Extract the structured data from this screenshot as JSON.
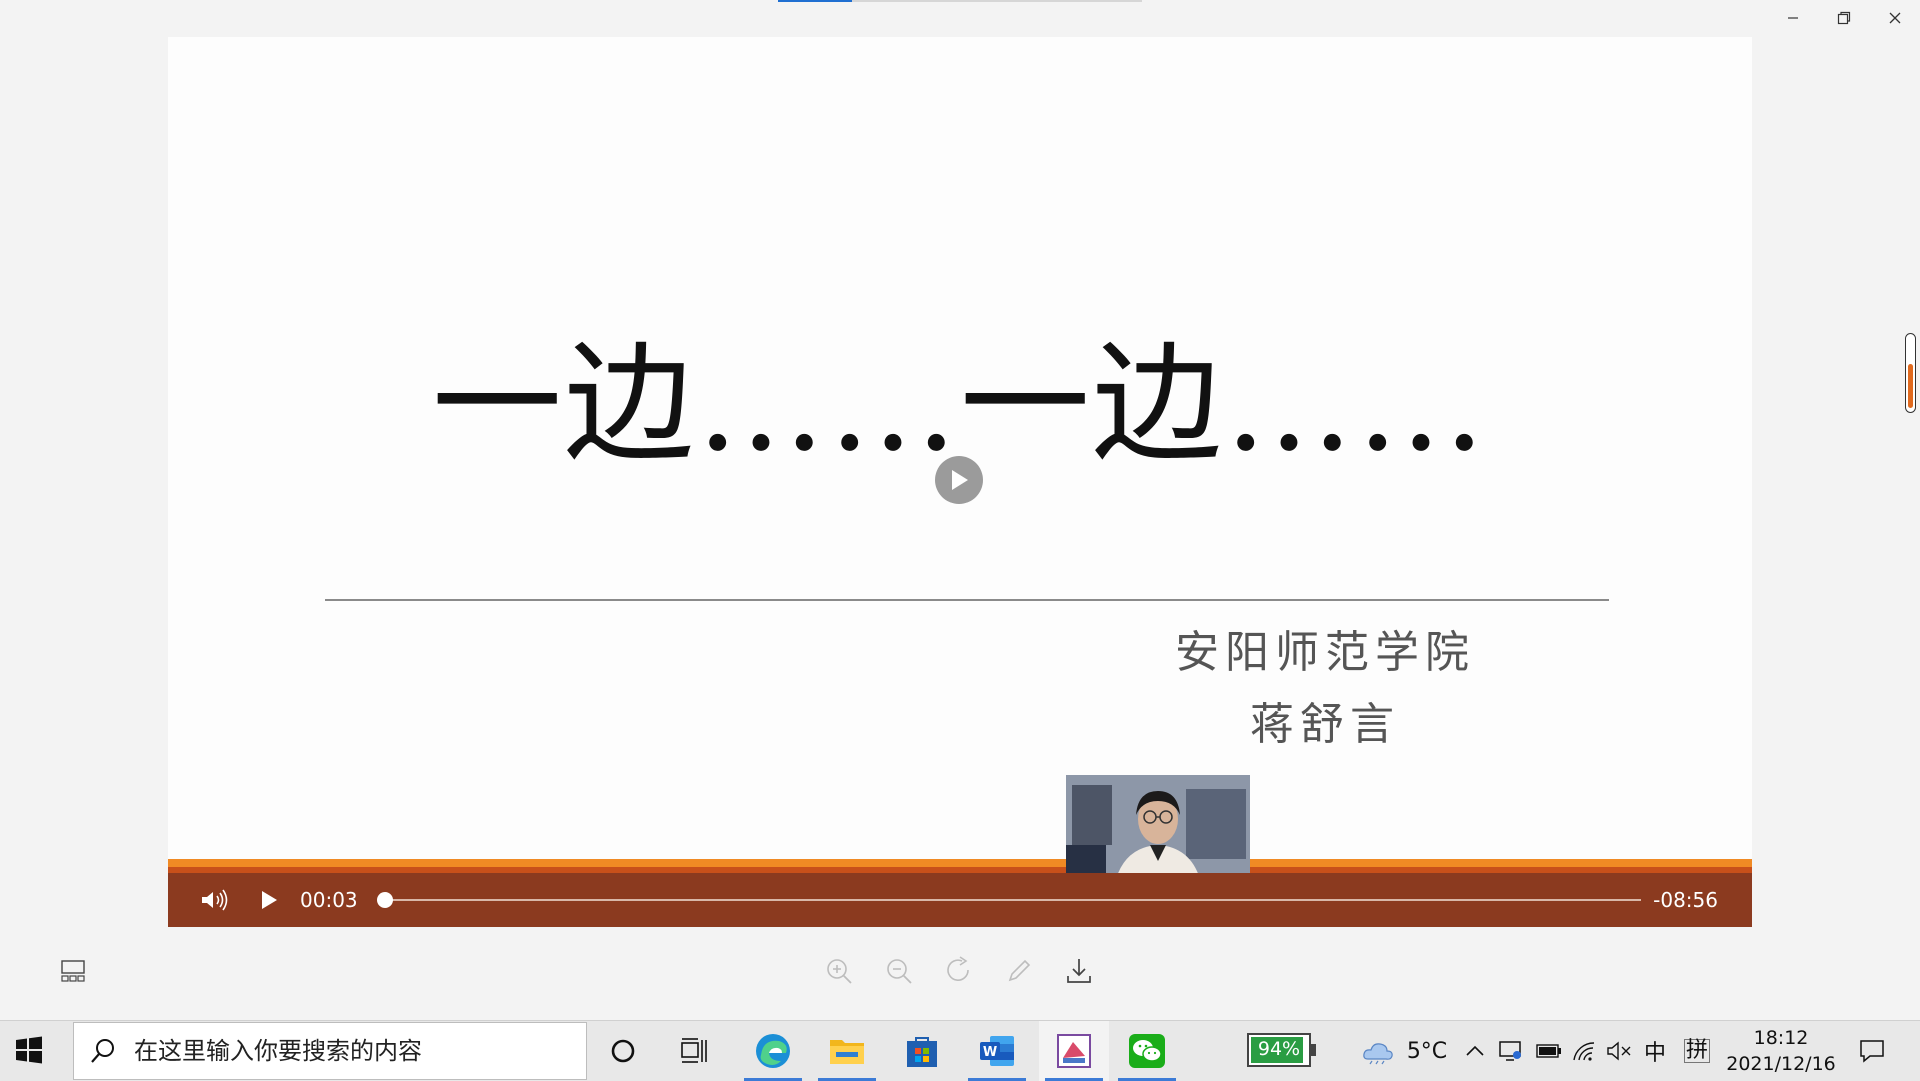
{
  "window": {
    "controls": [
      "minimize",
      "restore",
      "close"
    ]
  },
  "slide": {
    "title": "一边……一边……",
    "institution": "安阳师范学院",
    "author": "蒋舒言"
  },
  "player": {
    "time_current": "00:03",
    "time_remaining": "-08:56",
    "progress": 0.006,
    "state": "paused"
  },
  "toolbar": {
    "tools": [
      "zoom-in",
      "zoom-out",
      "rotate",
      "edit",
      "download"
    ]
  },
  "taskbar": {
    "search_placeholder": "在这里输入你要搜索的内容",
    "apps": [
      "cortana",
      "task-view",
      "edge",
      "file-explorer",
      "microsoft-store",
      "word",
      "image-viewer",
      "wechat"
    ],
    "battery_percent": "94%",
    "weather_temp": "5°C",
    "ime_lang": "中",
    "ime_mode": "拼",
    "time": "18:12",
    "date": "2021/12/16"
  },
  "colors": {
    "band_orange": "#f08a24",
    "controls_bg": "#8b3a1f",
    "battery_green": "#2a9d43"
  }
}
